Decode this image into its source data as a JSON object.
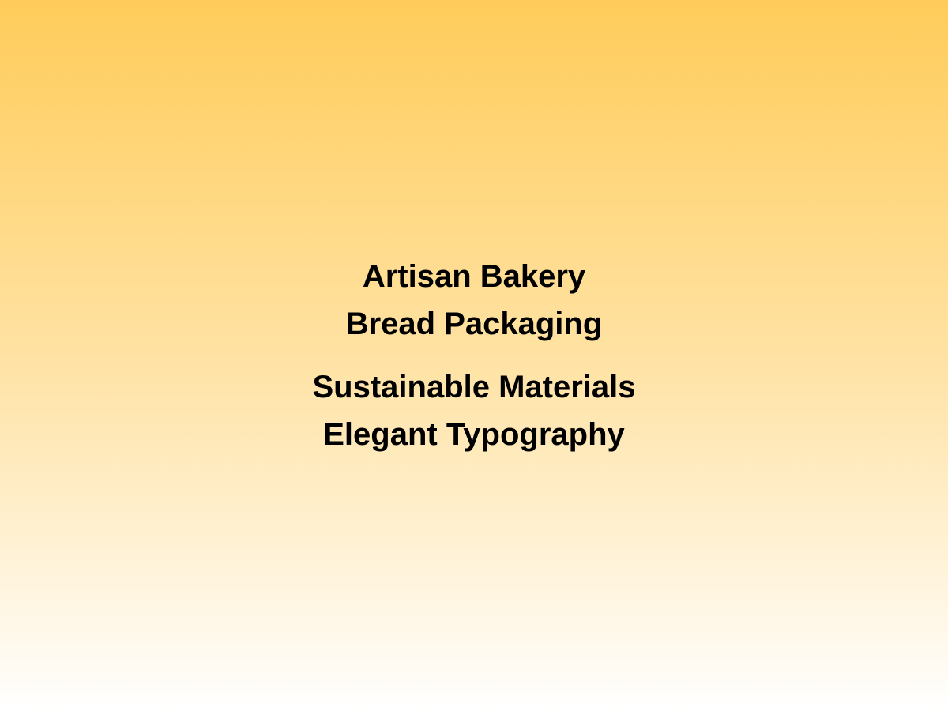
{
  "lines": [
    "Artisan Bakery",
    "Bread Packaging",
    "Sustainable Materials",
    "Elegant Typography"
  ],
  "colors": {
    "gradient_top": "#ffcc5a",
    "gradient_middle": "#ffe2a3",
    "gradient_bottom": "#ffffff",
    "text": "#000000"
  }
}
